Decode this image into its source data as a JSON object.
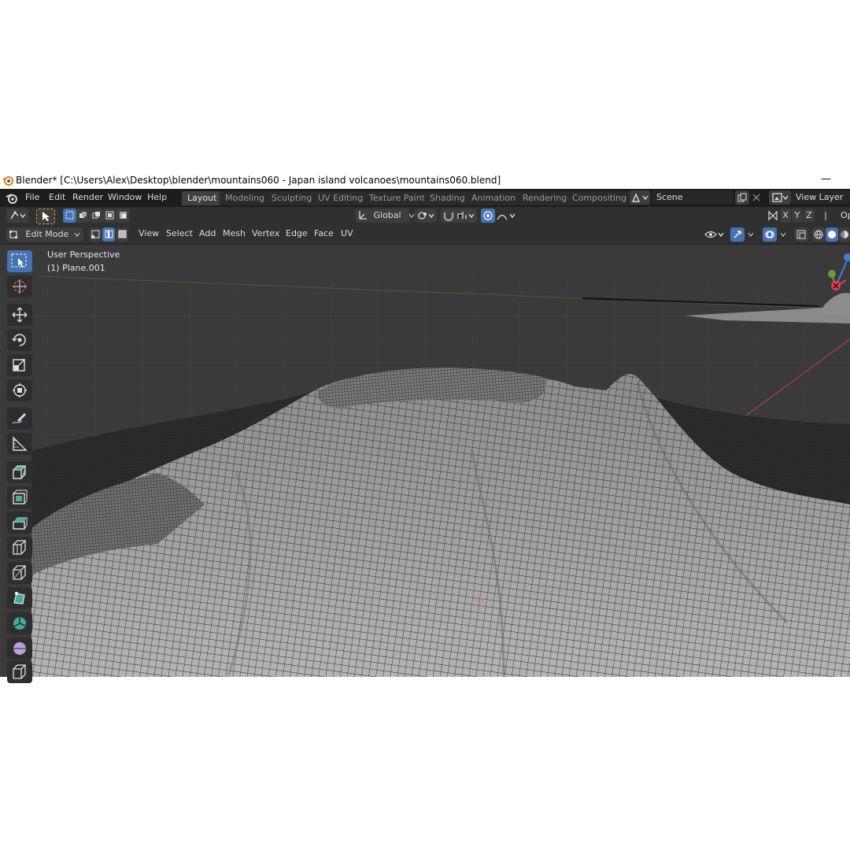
{
  "window": {
    "title": "Blender* [C:\\Users\\Alex\\Desktop\\blender\\mountains060 - Japan island volcanoes\\mountains060.blend]",
    "minimize_glyph": "—"
  },
  "menubar": {
    "items": [
      "File",
      "Edit",
      "Render",
      "Window",
      "Help"
    ],
    "workspaces": [
      "Layout",
      "Modeling",
      "Sculpting",
      "UV Editing",
      "Texture Paint",
      "Shading",
      "Animation",
      "Rendering",
      "Compositing"
    ],
    "active_workspace": "Layout",
    "scene": "Scene",
    "view_layer": "View Layer"
  },
  "toolrow": {
    "orientation": "Global",
    "axes": [
      "X",
      "Y",
      "Z"
    ],
    "options_label": "Op"
  },
  "moderow": {
    "mode": "Edit Mode",
    "menus": [
      "View",
      "Select",
      "Add",
      "Mesh",
      "Vertex",
      "Edge",
      "Face",
      "UV"
    ]
  },
  "viewport": {
    "view_name": "User Perspective",
    "object_name": "(1) Plane.001"
  },
  "toolbar": {
    "tools": [
      "select-box",
      "cursor",
      "move",
      "rotate",
      "scale",
      "transform",
      "annotate",
      "measure",
      "add-cube",
      "extrude",
      "inset",
      "bevel",
      "loop-cut",
      "knife",
      "poly-build",
      "spin",
      "smooth",
      "shear"
    ]
  },
  "colors": {
    "accent": "#4772b3",
    "viewport_bg": "#3a3a3a",
    "header_bg": "#303030",
    "topbar_bg": "#1d1d1d",
    "mesh_surface": "#9a9a9a",
    "wire": "#1a1a1a"
  }
}
